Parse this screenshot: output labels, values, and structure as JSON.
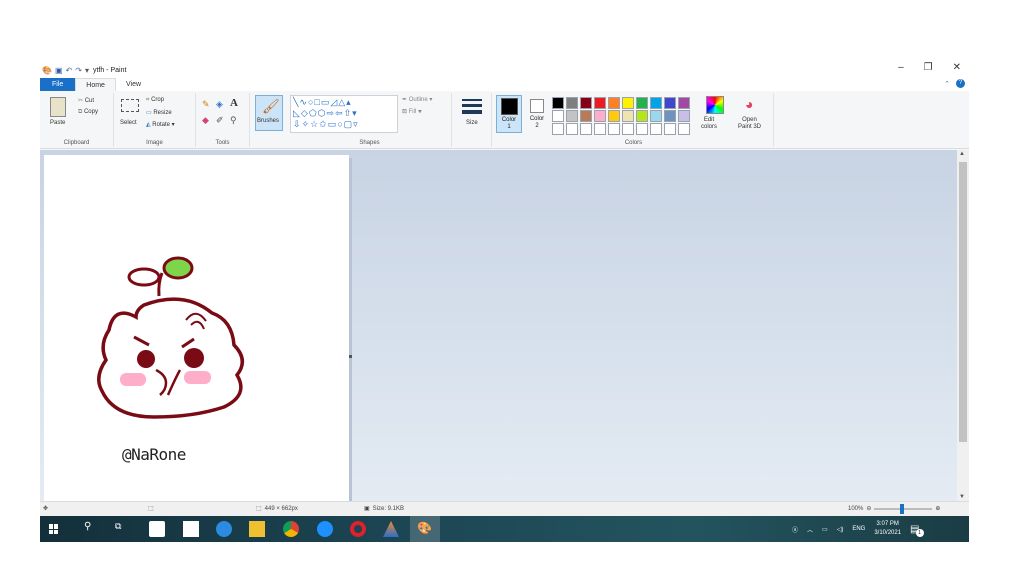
{
  "window": {
    "title": "ytfh - Paint",
    "minimize": "–",
    "maximize": "❐",
    "close": "✕"
  },
  "tabs": [
    "File",
    "Home",
    "View"
  ],
  "ribbon": {
    "clipboard": {
      "paste": "Paste",
      "cut": "Cut",
      "copy": "Copy",
      "label": "Clipboard"
    },
    "image": {
      "select": "Select",
      "crop": "Crop",
      "resize": "Resize",
      "rotate": "Rotate",
      "label": "Image"
    },
    "tools": {
      "label": "Tools"
    },
    "brushes": {
      "label": "Brushes"
    },
    "shapes": {
      "outline": "Outline",
      "fill": "Fill",
      "label": "Shapes"
    },
    "size": {
      "label": "Size"
    },
    "colors": {
      "color1": "Color\n1",
      "color2": "Color\n2",
      "edit_colors": "Edit\ncolors",
      "open_paint3d": "Open\nPaint 3D",
      "label": "Colors",
      "row1": [
        "#000000",
        "#7f7f7f",
        "#880015",
        "#ed1c24",
        "#ff7f27",
        "#fff200",
        "#22b14c",
        "#00a2e8",
        "#3f48cc",
        "#a349a4"
      ],
      "row2": [
        "#ffffff",
        "#c3c3c3",
        "#b97a57",
        "#ffaec9",
        "#ffc90e",
        "#efe4b0",
        "#b5e61d",
        "#99d9ea",
        "#7092be",
        "#c8bfe7"
      ],
      "row3": [
        "#ffffff",
        "#ffffff",
        "#ffffff",
        "#ffffff",
        "#ffffff",
        "#ffffff",
        "#ffffff",
        "#ffffff",
        "#ffffff",
        "#ffffff"
      ]
    }
  },
  "canvas": {
    "signature": "@NaRone"
  },
  "statusbar": {
    "dimensions": "449 × 662px",
    "size": "Size: 9.1KB",
    "zoom": "100%"
  },
  "taskbar": {
    "tray_lang": "ENG",
    "time": "3:07 PM",
    "date": "3/10/2021",
    "notif_count": "1"
  }
}
